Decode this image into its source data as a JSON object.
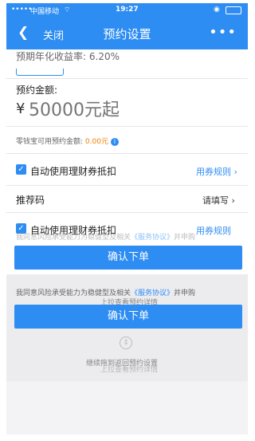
{
  "statusbar": {
    "carrier": "中国移动",
    "time": "19:27"
  },
  "nav": {
    "close": "关闭",
    "title": "预约设置",
    "more": "•••"
  },
  "rate": {
    "label": "预期年化收益率:",
    "value": "6.20%"
  },
  "amount": {
    "label": "预约金额:",
    "currency": "¥",
    "placeholder": "50000元起"
  },
  "balance": {
    "label": "零钱宝可用预约金额:",
    "value": "0.00元"
  },
  "voucher": {
    "label": "自动使用理财券抵扣",
    "rule_link": "用券规则"
  },
  "referral": {
    "label": "推荐码",
    "action": "请填写"
  },
  "agreement": {
    "text_prefix": "我同意风险承受能力为稳健型及相关",
    "link": "《服务协议》",
    "text_suffix": "并申购"
  },
  "confirm_button": "确认下单",
  "pull_up_hint": "上拉查看预约详情",
  "continue_hint": "继续拖到返回预约设置",
  "colors": {
    "primary": "#2e8df2",
    "orange": "#f07d00"
  }
}
